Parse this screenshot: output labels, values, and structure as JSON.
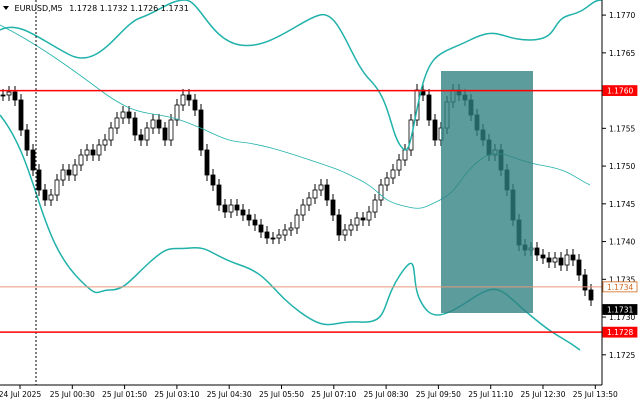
{
  "header": {
    "symbol": "EURUSD,M5",
    "ohlc": "1.1728 1.1732 1.1726 1.1731"
  },
  "price_axis": {
    "range": [
      1.1721,
      1.1772
    ],
    "ticks": [
      "1.1770",
      "1.1765",
      "1.1760",
      "1.1755",
      "1.1750",
      "1.1745",
      "1.1740",
      "1.1735",
      "1.1730",
      "1.1725"
    ]
  },
  "time_axis": {
    "labels": [
      "24 Jul 2025",
      "25 Jul 00:30",
      "25 Jul 01:50",
      "25 Jul 03:10",
      "25 Jul 04:30",
      "25 Jul 05:50",
      "25 Jul 07:10",
      "25 Jul 08:30",
      "25 Jul 09:50",
      "25 Jul 11:10",
      "25 Jul 12:30",
      "25 Jul 13:50"
    ]
  },
  "price_tags": [
    {
      "label": "1.1760",
      "value": 1.176,
      "bg": "#ff0000",
      "fg": "#ffffff"
    },
    {
      "label": "1.1734",
      "value": 1.1734,
      "bg": "#ffffff",
      "fg": "#d2691e",
      "border": "#d2691e"
    },
    {
      "label": "1.1731",
      "value": 1.1731,
      "bg": "#000000",
      "fg": "#ffffff"
    },
    {
      "label": "1.1728",
      "value": 1.1728,
      "bg": "#ff0000",
      "fg": "#ffffff"
    }
  ],
  "levels": [
    {
      "name": "resistance",
      "value": 1.176,
      "color": "#ff0000"
    },
    {
      "name": "orange-level",
      "value": 1.1734,
      "color": "#e9967a"
    },
    {
      "name": "support",
      "value": 1.1728,
      "color": "#ff0000"
    }
  ],
  "colors": {
    "bands": "#20b2aa",
    "candles": "#000000",
    "zone": "#2f8080",
    "grid": "#c0c0c0"
  }
}
